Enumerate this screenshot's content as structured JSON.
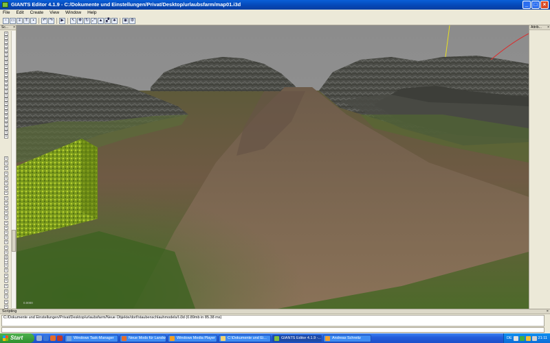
{
  "window": {
    "title": "GIANTS Editor 4.1.9 - C:/Dokumente und Einstellungen/Privat/Desktop/urlaubsfarm/map01.i3d",
    "buttons": [
      "_",
      "□",
      "×"
    ]
  },
  "menu": [
    "File",
    "Edit",
    "Create",
    "View",
    "Window",
    "Help"
  ],
  "toolbar_icons": [
    "new-icon",
    "open-icon",
    "import-icon",
    "export-icon",
    "save-icon",
    "sep",
    "undo-icon",
    "redo-icon",
    "sep",
    "play-icon",
    "sep",
    "select-icon",
    "move-icon",
    "rotate-icon",
    "scale-icon",
    "terrain-sculpt-icon",
    "terrain-paint-icon",
    "foliage-icon",
    "sep",
    "camera-icon",
    "settings-icon"
  ],
  "left_panel": {
    "title": "Sc...",
    "close": "×"
  },
  "right_panel": {
    "title": "Attrib...",
    "close": "×"
  },
  "viewport": {
    "overlay_text": "0.0000"
  },
  "scripting": {
    "title": "Scripting",
    "close": "×",
    "output": "C:/Dokumente und Einstellungen/Privat/Desktop/urlaubsfarm/Neue Objekte/dorf/staubenschlauhmodels/l.i3d (0.89mb in 85.38 ms)"
  },
  "taskbar": {
    "start": "Start",
    "tasks": [
      {
        "label": "Windows Task-Manager",
        "color": "#7aa7e0",
        "active": false
      },
      {
        "label": "Neue Mods für Landw...",
        "color": "#e36c2c",
        "active": false
      },
      {
        "label": "Windows Media Player",
        "color": "#f4a020",
        "active": false
      },
      {
        "label": "C:\\Dokumente und Ei...",
        "color": "#f1d272",
        "active": false
      },
      {
        "label": "GIANTS Editor 4.1.9 -...",
        "color": "#7fbf3f",
        "active": true
      },
      {
        "label": "Andreas Schreitz",
        "color": "#f0a030",
        "active": false
      }
    ],
    "tray_lang": "DE",
    "clock": "21:11"
  }
}
